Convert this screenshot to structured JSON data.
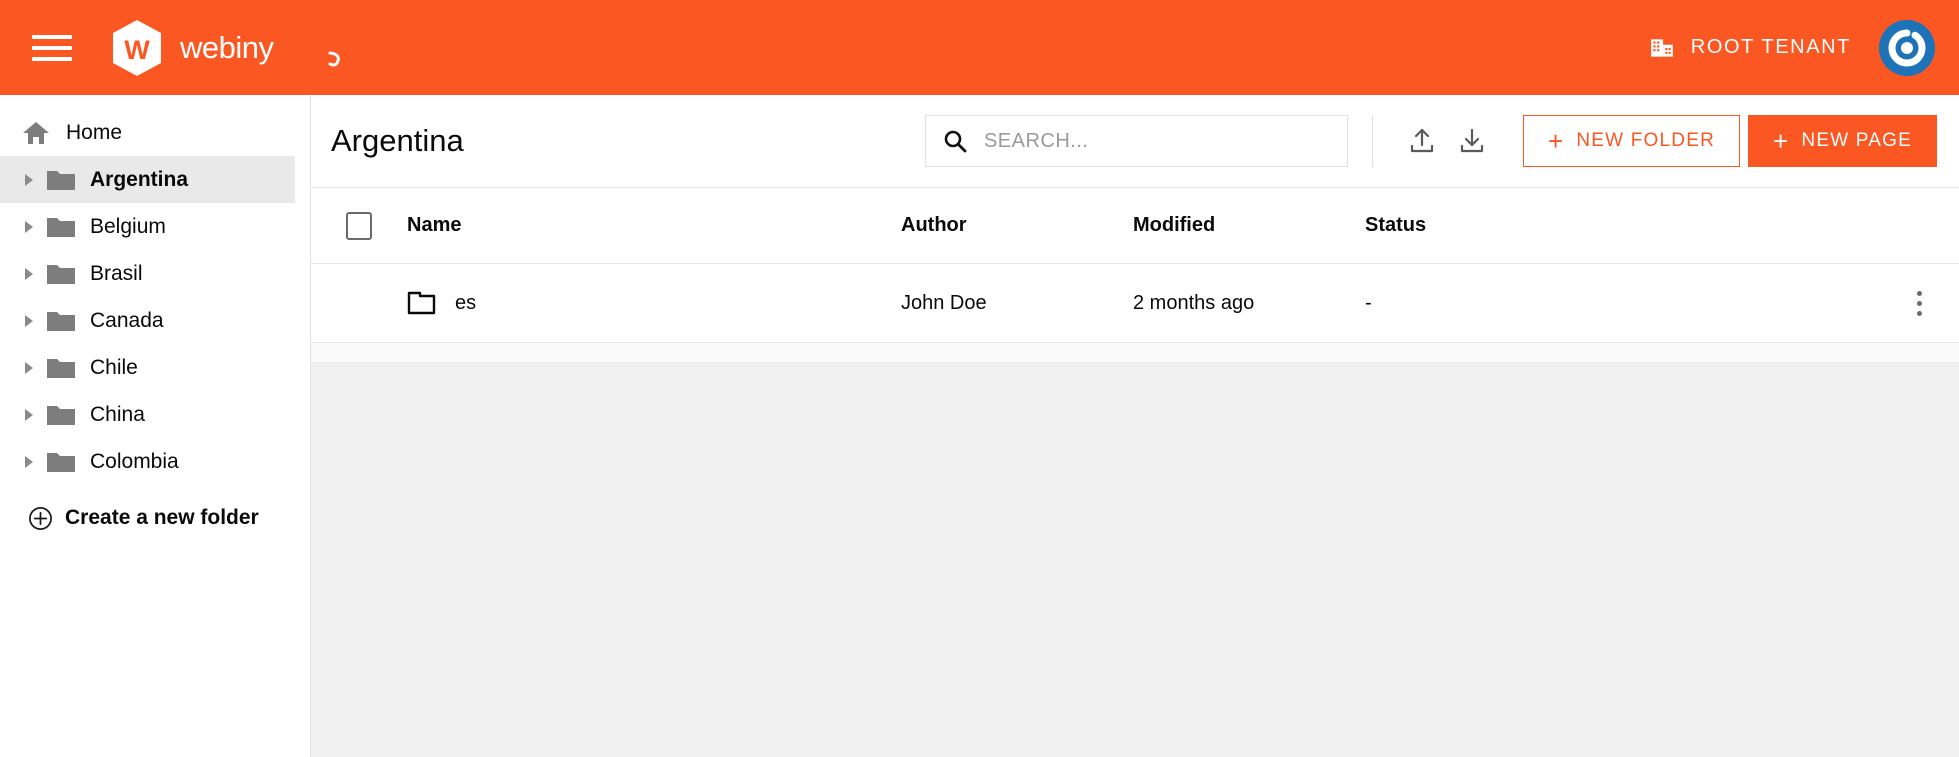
{
  "topbar": {
    "menu_icon": "hamburger-icon",
    "brand_name": "webiny",
    "tenant_icon": "building-icon",
    "tenant_label": "ROOT TENANT",
    "avatar_icon": "user-avatar",
    "background_color": "#fa5723"
  },
  "sidebar": {
    "home": {
      "label": "Home",
      "icon": "home-icon"
    },
    "items": [
      {
        "label": "Argentina",
        "icon": "folder-icon",
        "caret": "caret-right-icon",
        "selected": true
      },
      {
        "label": "Belgium",
        "icon": "folder-icon",
        "caret": "caret-right-icon",
        "selected": false
      },
      {
        "label": "Brasil",
        "icon": "folder-icon",
        "caret": "caret-right-icon",
        "selected": false
      },
      {
        "label": "Canada",
        "icon": "folder-icon",
        "caret": "caret-right-icon",
        "selected": false
      },
      {
        "label": "Chile",
        "icon": "folder-icon",
        "caret": "caret-right-icon",
        "selected": false
      },
      {
        "label": "China",
        "icon": "folder-icon",
        "caret": "caret-right-icon",
        "selected": false
      },
      {
        "label": "Colombia",
        "icon": "folder-icon",
        "caret": "caret-right-icon",
        "selected": false
      }
    ],
    "create_folder": {
      "label": "Create a new folder",
      "icon": "plus-circle-icon"
    }
  },
  "main": {
    "title": "Argentina",
    "search": {
      "placeholder": "SEARCH...",
      "value": "",
      "icon": "search-icon"
    },
    "upload_icon": "upload-icon",
    "download_icon": "download-icon",
    "new_folder_button": {
      "label": "NEW FOLDER",
      "plus": "+"
    },
    "new_page_button": {
      "label": "NEW PAGE",
      "plus": "+"
    },
    "accent_color": "#fa5723"
  },
  "table": {
    "columns": [
      "Name",
      "Author",
      "Modified",
      "Status"
    ],
    "rows": [
      {
        "icon": "folder-outline-icon",
        "name": "es",
        "author": "John Doe",
        "modified": "2 months ago",
        "status": "-",
        "actions_icon": "kebab-menu-icon"
      }
    ]
  }
}
